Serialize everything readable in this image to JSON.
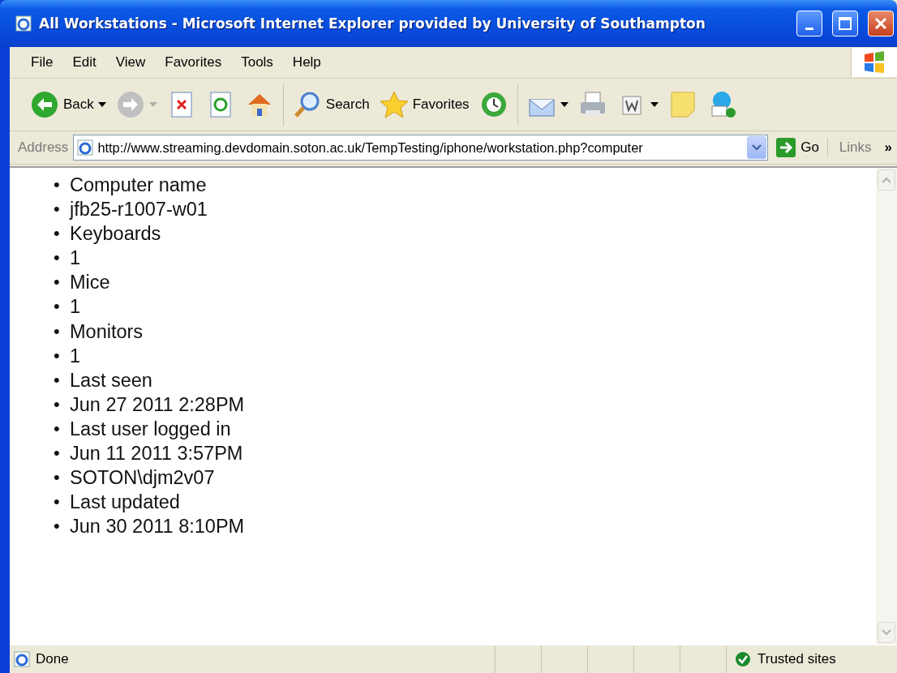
{
  "window": {
    "title": "All Workstations - Microsoft Internet Explorer provided by University of Southampton"
  },
  "menu": [
    "File",
    "Edit",
    "View",
    "Favorites",
    "Tools",
    "Help"
  ],
  "toolbar": [
    [
      {
        "kind": "back",
        "label": "Back",
        "dropdown": true
      },
      {
        "kind": "forward",
        "dropdown": true,
        "disabled": true
      },
      {
        "kind": "stop"
      },
      {
        "kind": "refresh"
      },
      {
        "kind": "home"
      }
    ],
    [
      {
        "kind": "search",
        "label": "Search"
      },
      {
        "kind": "favorites",
        "label": "Favorites"
      },
      {
        "kind": "history"
      }
    ],
    [
      {
        "kind": "mail",
        "dropdown": true
      },
      {
        "kind": "print"
      },
      {
        "kind": "word",
        "dropdown": true
      },
      {
        "kind": "notes"
      },
      {
        "kind": "skype"
      }
    ]
  ],
  "address": {
    "label": "Address",
    "url": "http://www.streaming.devdomain.soton.ac.uk/TempTesting/iphone/workstation.php?computer",
    "go": "Go",
    "links": "Links",
    "more": "»"
  },
  "content": {
    "items": [
      {
        "marker": "•",
        "text": "Computer name"
      },
      {
        "marker": "•",
        "text": "jfb25-r1007-w01"
      },
      {
        "marker": "•",
        "text": "Keyboards"
      },
      {
        "marker": "•",
        "text": "1"
      },
      {
        "marker": "•",
        "text": "Mice"
      },
      {
        "marker": "•",
        "text": "1"
      },
      {
        "marker": "•",
        "text": "Monitors"
      },
      {
        "marker": "•",
        "text": "1"
      },
      {
        "marker": "•",
        "text": "Last seen"
      },
      {
        "marker": "•",
        "text": "Jun 27 2011 2:28PM"
      },
      {
        "marker": "•",
        "text": "Last user logged in"
      },
      {
        "marker": "•",
        "text": "Jun 11 2011 3:57PM"
      },
      {
        "marker": "•",
        "text": "SOTON\\djm2v07"
      },
      {
        "marker": "•",
        "text": "Last updated"
      },
      {
        "marker": "•",
        "text": "Jun 30 2011 8:10PM"
      }
    ]
  },
  "status_bar": {
    "text": "Done",
    "zone": "Trusted sites"
  }
}
